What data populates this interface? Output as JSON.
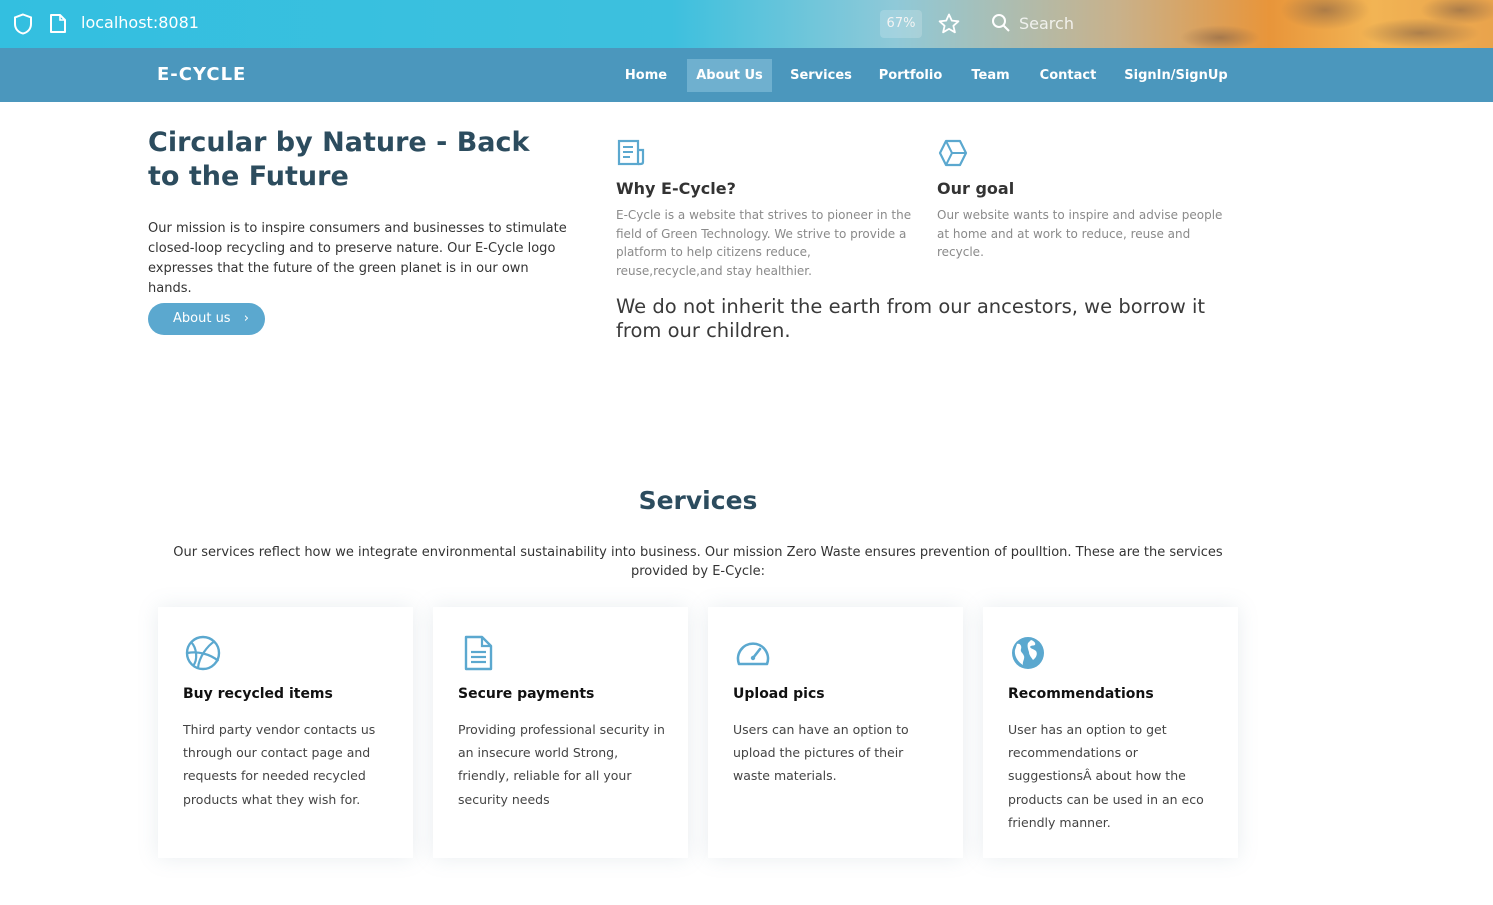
{
  "browser": {
    "url": "localhost:8081",
    "zoom": "67%",
    "search_placeholder": "Search"
  },
  "nav": {
    "logo": "E-CYCLE",
    "items": [
      {
        "label": "Home",
        "active": false
      },
      {
        "label": "About Us",
        "active": true
      },
      {
        "label": "Services",
        "active": false
      },
      {
        "label": "Portfolio",
        "active": false
      },
      {
        "label": "Team",
        "active": false
      },
      {
        "label": "Contact",
        "active": false
      },
      {
        "label": "SignIn/SignUp",
        "active": false
      }
    ]
  },
  "hero": {
    "title": "Circular by Nature - Back to the Future",
    "text": "Our mission is to inspire consumers and businesses to stimulate closed-loop recycling and to preserve nature. Our E-Cycle logo expresses that the future of the green planet is in our own hands.",
    "button_label": "About us",
    "button_icon": "chevron-right-icon"
  },
  "features": [
    {
      "icon": "document-icon",
      "title": "Why E-Cycle?",
      "text": "E-Cycle is a website that strives to pioneer in the field of Green Technology. We strive to provide a platform to help citizens reduce, reuse,recycle,and stay healthier."
    },
    {
      "icon": "cube-icon",
      "title": "Our goal",
      "text": "Our website wants to inspire and advise people at home and at work to reduce, reuse and recycle."
    }
  ],
  "quote": "We do not inherit the earth from our ancestors, we borrow it from our children.",
  "services": {
    "title": "Services",
    "intro": "Our services reflect how we integrate environmental sustainability into business. Our mission Zero Waste ensures prevention of poulltion. These are the services provided by E-Cycle:",
    "cards": [
      {
        "icon": "basketball-icon",
        "title": "Buy recycled items",
        "text": "Third party vendor contacts us through our contact page and requests for needed recycled products what they wish for."
      },
      {
        "icon": "file-text-icon",
        "title": "Secure payments",
        "text": "Providing professional security in an insecure world Strong, friendly, reliable for all your security needs"
      },
      {
        "icon": "speedometer-icon",
        "title": "Upload pics",
        "text": "Users can have an option to upload the pictures of their waste materials."
      },
      {
        "icon": "globe-icon",
        "title": "Recommendations",
        "text": "User has an option to get recommendations or suggestionsÂ about how the products can be used in an eco friendly manner."
      }
    ]
  },
  "colors": {
    "nav_bg": "#4b97bd",
    "nav_active": "#6fb0cf",
    "accent": "#5ba8cf",
    "heading": "#2c4c5e"
  }
}
